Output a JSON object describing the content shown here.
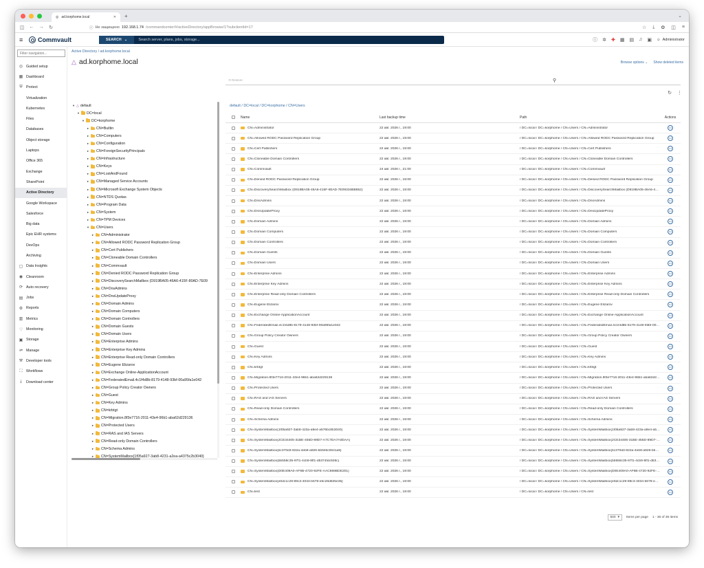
{
  "browser": {
    "tab_title": "ad.korphome.local",
    "not_secure": "Не защищено",
    "url_host": "192.168.1.74",
    "url_path": "/commandcenter/#/activeDirectory/appBrowse/1?subclientId=17"
  },
  "app": {
    "brand": "Commvault",
    "search_button": "SEARCH",
    "search_placeholder": "Search server, plans, jobs, storage...",
    "user": "Administrator"
  },
  "sidebar": {
    "filter_placeholder": "Filter navigation...",
    "items": [
      {
        "label": "Guided setup",
        "icon": "guided-setup-icon",
        "sub": false
      },
      {
        "label": "Dashboard",
        "icon": "dashboard-icon",
        "sub": false
      },
      {
        "label": "Protect",
        "icon": "protect-icon",
        "sub": false
      },
      {
        "label": "Virtualization",
        "sub": true
      },
      {
        "label": "Kubernetes",
        "sub": true
      },
      {
        "label": "Files",
        "sub": true
      },
      {
        "label": "Databases",
        "sub": true
      },
      {
        "label": "Object storage",
        "sub": true
      },
      {
        "label": "Laptops",
        "sub": true
      },
      {
        "label": "Office 365",
        "sub": true
      },
      {
        "label": "Exchange",
        "sub": true
      },
      {
        "label": "SharePoint",
        "sub": true
      },
      {
        "label": "Active Directory",
        "sub": true,
        "active": true
      },
      {
        "label": "Google Workspace",
        "sub": true
      },
      {
        "label": "Salesforce",
        "sub": true
      },
      {
        "label": "Big data",
        "sub": true
      },
      {
        "label": "Epic EHR systems",
        "sub": true
      },
      {
        "label": "DevOps",
        "sub": true
      },
      {
        "label": "Archiving",
        "sub": true
      },
      {
        "label": "Data Insights",
        "icon": "data-insights-icon",
        "sub": false
      },
      {
        "label": "Cleanroom",
        "icon": "cleanroom-icon",
        "sub": false
      },
      {
        "label": "Auto recovery",
        "icon": "auto-recovery-icon",
        "sub": false
      },
      {
        "label": "Jobs",
        "icon": "jobs-icon",
        "sub": false
      },
      {
        "label": "Reports",
        "icon": "reports-icon",
        "sub": false
      },
      {
        "label": "Metrics",
        "icon": "metrics-icon",
        "sub": false
      },
      {
        "label": "Monitoring",
        "icon": "monitoring-icon",
        "sub": false
      },
      {
        "label": "Storage",
        "icon": "storage-icon",
        "sub": false
      },
      {
        "label": "Manage",
        "icon": "manage-icon",
        "sub": false
      },
      {
        "label": "Developer tools",
        "icon": "developer-tools-icon",
        "sub": false
      },
      {
        "label": "Workflows",
        "icon": "workflows-icon",
        "sub": false
      },
      {
        "label": "Download center",
        "icon": "download-center-icon",
        "sub": false
      }
    ]
  },
  "page": {
    "breadcrumb_root": "Active Directory",
    "breadcrumb_current": "ad.korphome.local",
    "title": "ad.korphome.local",
    "browse_options": "Browse options",
    "show_deleted": "Show deleted items",
    "restore": "Restore"
  },
  "tree": [
    {
      "level": 0,
      "label": "default",
      "exp": "open",
      "type": "domain"
    },
    {
      "level": 1,
      "label": "DC=local",
      "exp": "open"
    },
    {
      "level": 2,
      "label": "DC=korphome",
      "exp": "open"
    },
    {
      "level": 3,
      "label": "CN=Builtin",
      "exp": "closed"
    },
    {
      "level": 3,
      "label": "CN=Computers",
      "exp": "closed"
    },
    {
      "level": 3,
      "label": "CN=Configuration",
      "exp": "closed"
    },
    {
      "level": 3,
      "label": "CN=ForeignSecurityPrincipals",
      "exp": "closed"
    },
    {
      "level": 3,
      "label": "CN=Infrastructure",
      "exp": "closed"
    },
    {
      "level": 3,
      "label": "CN=Keys",
      "exp": "closed"
    },
    {
      "level": 3,
      "label": "CN=LostAndFound",
      "exp": "closed"
    },
    {
      "level": 3,
      "label": "CN=Managed Service Accounts",
      "exp": "closed"
    },
    {
      "level": 3,
      "label": "CN=Microsoft Exchange System Objects",
      "exp": "closed"
    },
    {
      "level": 3,
      "label": "CN=NTDS Quotas",
      "exp": "closed"
    },
    {
      "level": 3,
      "label": "CN=Program Data",
      "exp": "closed"
    },
    {
      "level": 3,
      "label": "CN=System",
      "exp": "closed"
    },
    {
      "level": 3,
      "label": "CN=TPM Devices",
      "exp": "closed"
    },
    {
      "level": 3,
      "label": "CN=Users",
      "exp": "open"
    },
    {
      "level": 4,
      "label": "CN=Administrator",
      "exp": "closed"
    },
    {
      "level": 4,
      "label": "CN=Allowed RODC Password Replication Group",
      "exp": "closed"
    },
    {
      "level": 4,
      "label": "CN=Cert Publishers",
      "exp": "closed"
    },
    {
      "level": 4,
      "label": "CN=Cloneable Domain Controllers",
      "exp": "closed"
    },
    {
      "level": 4,
      "label": "CN=Commvault",
      "exp": "closed"
    },
    {
      "level": 4,
      "label": "CN=Denied RODC Password Replication Group",
      "exp": "closed"
    },
    {
      "level": 4,
      "label": "CN=DiscoverySearchMailbox (D919BA05-46A6-415F-80AD-7E09",
      "exp": "closed"
    },
    {
      "level": 4,
      "label": "CN=DnsAdmins",
      "exp": "closed"
    },
    {
      "level": 4,
      "label": "CN=DnsUpdateProxy",
      "exp": "closed"
    },
    {
      "level": 4,
      "label": "CN=Domain Admins",
      "exp": "closed"
    },
    {
      "level": 4,
      "label": "CN=Domain Computers",
      "exp": "closed"
    },
    {
      "level": 4,
      "label": "CN=Domain Controllers",
      "exp": "closed"
    },
    {
      "level": 4,
      "label": "CN=Domain Guests",
      "exp": "closed"
    },
    {
      "level": 4,
      "label": "CN=Domain Users",
      "exp": "closed"
    },
    {
      "level": 4,
      "label": "CN=Enterprise Admins",
      "exp": "closed"
    },
    {
      "level": 4,
      "label": "CN=Enterprise Key Admins",
      "exp": "closed"
    },
    {
      "level": 4,
      "label": "CN=Enterprise Read-only Domain Controllers",
      "exp": "closed"
    },
    {
      "level": 4,
      "label": "CN=Eugene Elizarov",
      "exp": "closed"
    },
    {
      "level": 4,
      "label": "CN=Exchange Online-ApplicationAccount",
      "exp": "closed"
    },
    {
      "level": 4,
      "label": "CN=FederatedEmail.4c1f4d8b-8179-4148-93bf-00a95fa1e042",
      "exp": "closed"
    },
    {
      "level": 4,
      "label": "CN=Group Policy Creator Owners",
      "exp": "closed"
    },
    {
      "level": 4,
      "label": "CN=Guest",
      "exp": "closed"
    },
    {
      "level": 4,
      "label": "CN=Key Admins",
      "exp": "closed"
    },
    {
      "level": 4,
      "label": "CN=krbtgt",
      "exp": "closed"
    },
    {
      "level": 4,
      "label": "CN=Migration.8f3e7716-2011-43e4-96b1-aba62d229136",
      "exp": "closed"
    },
    {
      "level": 4,
      "label": "CN=Protected Users",
      "exp": "closed"
    },
    {
      "level": 4,
      "label": "CN=RAS and IAS Servers",
      "exp": "closed"
    },
    {
      "level": 4,
      "label": "CN=Read-only Domain Controllers",
      "exp": "closed"
    },
    {
      "level": 4,
      "label": "CN=Schema Admins",
      "exp": "closed"
    },
    {
      "level": 4,
      "label": "CN=SystemMailbox{1f05a927-3ab8-4231-a2ea-a4375c2b3040}",
      "exp": "closed"
    }
  ],
  "table": {
    "breadcrumb": [
      "default",
      "DC=local",
      "DC=korphome",
      "CN=Users"
    ],
    "columns": {
      "name": "Name",
      "time": "Last backup time",
      "path": "Path",
      "actions": "Actions"
    },
    "path_prefix": "/ DC=local / DC=korphome / CN=Users / ",
    "rows": [
      {
        "name": "CN=Administrator",
        "time": "22 авг. 2026 г., 19:00"
      },
      {
        "name": "CN=Allowed RODC Password Replication Group",
        "time": "22 авг. 2026 г., 19:00"
      },
      {
        "name": "CN=Cert Publishers",
        "time": "22 авг. 2026 г., 19:00"
      },
      {
        "name": "CN=Cloneable Domain Controllers",
        "time": "22 авг. 2026 г., 19:00"
      },
      {
        "name": "CN=Commvault",
        "time": "24 авг. 2026 г., 21:00"
      },
      {
        "name": "CN=Denied RODC Password Replication Group",
        "time": "22 авг. 2026 г., 19:00"
      },
      {
        "name": "CN=DiscoverySearchMailbox (D919BA05-46A6-415F-80AD-7E09334BB852)",
        "time": "22 авг. 2026 г., 19:00"
      },
      {
        "name": "CN=DnsAdmins",
        "time": "22 авг. 2026 г., 19:00"
      },
      {
        "name": "CN=DnsUpdateProxy",
        "time": "22 авг. 2026 г., 19:00"
      },
      {
        "name": "CN=Domain Admins",
        "time": "22 авг. 2026 г., 19:00"
      },
      {
        "name": "CN=Domain Computers",
        "time": "22 авг. 2026 г., 19:00"
      },
      {
        "name": "CN=Domain Controllers",
        "time": "22 авг. 2026 г., 19:00"
      },
      {
        "name": "CN=Domain Guests",
        "time": "22 авг. 2026 г., 19:00"
      },
      {
        "name": "CN=Domain Users",
        "time": "22 авг. 2026 г., 19:00"
      },
      {
        "name": "CN=Enterprise Admins",
        "time": "22 авг. 2026 г., 19:00"
      },
      {
        "name": "CN=Enterprise Key Admins",
        "time": "22 авг. 2026 г., 19:00"
      },
      {
        "name": "CN=Enterprise Read-only Domain Controllers",
        "time": "22 авг. 2026 г., 19:00"
      },
      {
        "name": "CN=Eugene Elizarov",
        "time": "22 авг. 2026 г., 19:00"
      },
      {
        "name": "CN=Exchange Online-ApplicationAccount",
        "time": "22 авг. 2026 г., 19:00"
      },
      {
        "name": "CN=FederatedEmail.4c1f4d8b-8179-4148-93bf-00a95fa1e042",
        "time": "22 авг. 2026 г., 19:00"
      },
      {
        "name": "CN=Group Policy Creator Owners",
        "time": "22 авг. 2026 г., 19:00"
      },
      {
        "name": "CN=Guest",
        "time": "22 авг. 2026 г., 19:00"
      },
      {
        "name": "CN=Key Admins",
        "time": "22 авг. 2026 г., 19:00"
      },
      {
        "name": "CN=krbtgt",
        "time": "22 авг. 2026 г., 19:00"
      },
      {
        "name": "CN=Migration.8f3e7716-2011-43e4-96b1-aba62d229136",
        "time": "22 авг. 2026 г., 19:00"
      },
      {
        "name": "CN=Protected Users",
        "time": "22 авг. 2026 г., 19:00"
      },
      {
        "name": "CN=RAS and IAS Servers",
        "time": "22 авг. 2026 г., 19:00"
      },
      {
        "name": "CN=Read-only Domain Controllers",
        "time": "22 авг. 2026 г., 19:00"
      },
      {
        "name": "CN=Schema Admins",
        "time": "22 авг. 2026 г., 19:00"
      },
      {
        "name": "CN=SystemMailbox{1f05a927-3ab8-423a-a9e4-a576bc8b3040}",
        "time": "22 авг. 2026 г., 19:00"
      },
      {
        "name": "CN=SystemMailbox{2CE34405-31BE-455D-89D7-A7C7DA7A0DAA}",
        "time": "22 авг. 2026 г., 19:00"
      },
      {
        "name": "CN=SystemMailbox{bc370d3-822a-4eb8-a926-bb946c0641a9}",
        "time": "22 авг. 2026 г., 19:00"
      },
      {
        "name": "CN=SystemMailbox{bb558c35-97f1-4cb9-8ff1-d5374fdc928c}",
        "time": "22 авг. 2026 г., 19:00"
      },
      {
        "name": "CN=SystemMailbox{D0E409A0-AF9B-4720-92FE-AAC869BDE201}",
        "time": "22 авг. 2026 г., 19:00"
      },
      {
        "name": "CN=SystemMailbox{e0dc1c29-89c3-4034-b678-e6c28d825e35}",
        "time": "22 авг. 2026 г., 19:00"
      },
      {
        "name": "CN=test",
        "time": "22 авг. 2026 г., 19:00"
      }
    ],
    "page_size": "500",
    "items_per_page": "Items per page",
    "range": "1 - 36 of 36 items"
  }
}
